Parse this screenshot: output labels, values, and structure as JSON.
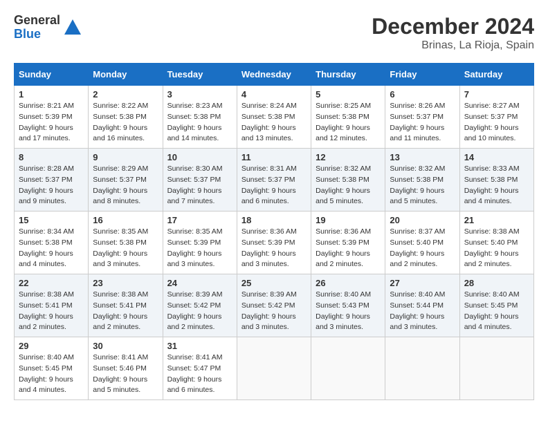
{
  "header": {
    "logo": {
      "general": "General",
      "blue": "Blue"
    },
    "title": "December 2024",
    "location": "Brinas, La Rioja, Spain"
  },
  "calendar": {
    "columns": [
      "Sunday",
      "Monday",
      "Tuesday",
      "Wednesday",
      "Thursday",
      "Friday",
      "Saturday"
    ],
    "weeks": [
      [
        null,
        {
          "day": "2",
          "sunrise": "8:22 AM",
          "sunset": "5:38 PM",
          "daylight": "9 hours and 16 minutes."
        },
        {
          "day": "3",
          "sunrise": "8:23 AM",
          "sunset": "5:38 PM",
          "daylight": "9 hours and 14 minutes."
        },
        {
          "day": "4",
          "sunrise": "8:24 AM",
          "sunset": "5:38 PM",
          "daylight": "9 hours and 13 minutes."
        },
        {
          "day": "5",
          "sunrise": "8:25 AM",
          "sunset": "5:38 PM",
          "daylight": "9 hours and 12 minutes."
        },
        {
          "day": "6",
          "sunrise": "8:26 AM",
          "sunset": "5:37 PM",
          "daylight": "9 hours and 11 minutes."
        },
        {
          "day": "7",
          "sunrise": "8:27 AM",
          "sunset": "5:37 PM",
          "daylight": "9 hours and 10 minutes."
        }
      ],
      [
        {
          "day": "1",
          "sunrise": "8:21 AM",
          "sunset": "5:39 PM",
          "daylight": "9 hours and 17 minutes."
        },
        {
          "day": "9",
          "sunrise": "8:29 AM",
          "sunset": "5:37 PM",
          "daylight": "9 hours and 8 minutes."
        },
        {
          "day": "10",
          "sunrise": "8:30 AM",
          "sunset": "5:37 PM",
          "daylight": "9 hours and 7 minutes."
        },
        {
          "day": "11",
          "sunrise": "8:31 AM",
          "sunset": "5:37 PM",
          "daylight": "9 hours and 6 minutes."
        },
        {
          "day": "12",
          "sunrise": "8:32 AM",
          "sunset": "5:38 PM",
          "daylight": "9 hours and 5 minutes."
        },
        {
          "day": "13",
          "sunrise": "8:32 AM",
          "sunset": "5:38 PM",
          "daylight": "9 hours and 5 minutes."
        },
        {
          "day": "14",
          "sunrise": "8:33 AM",
          "sunset": "5:38 PM",
          "daylight": "9 hours and 4 minutes."
        }
      ],
      [
        {
          "day": "8",
          "sunrise": "8:28 AM",
          "sunset": "5:37 PM",
          "daylight": "9 hours and 9 minutes."
        },
        {
          "day": "16",
          "sunrise": "8:35 AM",
          "sunset": "5:38 PM",
          "daylight": "9 hours and 3 minutes."
        },
        {
          "day": "17",
          "sunrise": "8:35 AM",
          "sunset": "5:39 PM",
          "daylight": "9 hours and 3 minutes."
        },
        {
          "day": "18",
          "sunrise": "8:36 AM",
          "sunset": "5:39 PM",
          "daylight": "9 hours and 3 minutes."
        },
        {
          "day": "19",
          "sunrise": "8:36 AM",
          "sunset": "5:39 PM",
          "daylight": "9 hours and 2 minutes."
        },
        {
          "day": "20",
          "sunrise": "8:37 AM",
          "sunset": "5:40 PM",
          "daylight": "9 hours and 2 minutes."
        },
        {
          "day": "21",
          "sunrise": "8:38 AM",
          "sunset": "5:40 PM",
          "daylight": "9 hours and 2 minutes."
        }
      ],
      [
        {
          "day": "15",
          "sunrise": "8:34 AM",
          "sunset": "5:38 PM",
          "daylight": "9 hours and 4 minutes."
        },
        {
          "day": "23",
          "sunrise": "8:38 AM",
          "sunset": "5:41 PM",
          "daylight": "9 hours and 2 minutes."
        },
        {
          "day": "24",
          "sunrise": "8:39 AM",
          "sunset": "5:42 PM",
          "daylight": "9 hours and 2 minutes."
        },
        {
          "day": "25",
          "sunrise": "8:39 AM",
          "sunset": "5:42 PM",
          "daylight": "9 hours and 3 minutes."
        },
        {
          "day": "26",
          "sunrise": "8:40 AM",
          "sunset": "5:43 PM",
          "daylight": "9 hours and 3 minutes."
        },
        {
          "day": "27",
          "sunrise": "8:40 AM",
          "sunset": "5:44 PM",
          "daylight": "9 hours and 3 minutes."
        },
        {
          "day": "28",
          "sunrise": "8:40 AM",
          "sunset": "5:45 PM",
          "daylight": "9 hours and 4 minutes."
        }
      ],
      [
        {
          "day": "22",
          "sunrise": "8:38 AM",
          "sunset": "5:41 PM",
          "daylight": "9 hours and 2 minutes."
        },
        {
          "day": "30",
          "sunrise": "8:41 AM",
          "sunset": "5:46 PM",
          "daylight": "9 hours and 5 minutes."
        },
        {
          "day": "31",
          "sunrise": "8:41 AM",
          "sunset": "5:47 PM",
          "daylight": "9 hours and 6 minutes."
        },
        null,
        null,
        null,
        null
      ],
      [
        {
          "day": "29",
          "sunrise": "8:40 AM",
          "sunset": "5:45 PM",
          "daylight": "9 hours and 4 minutes."
        },
        null,
        null,
        null,
        null,
        null,
        null
      ]
    ]
  }
}
